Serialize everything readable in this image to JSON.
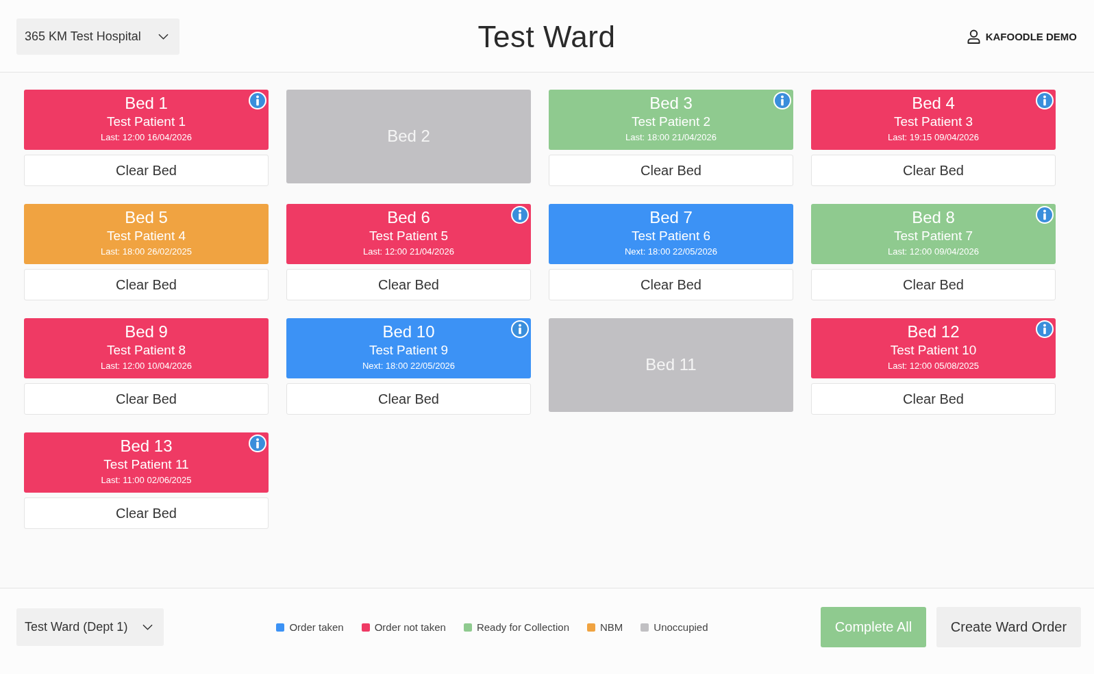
{
  "header": {
    "hospital_select": "365 KM Test Hospital",
    "title": "Test Ward",
    "user": "KAFOODLE DEMO"
  },
  "beds": [
    {
      "kind": "occupied",
      "name": "Bed 1",
      "patient": "Test Patient 1",
      "order_time": "Last: 12:00 16/04/2026",
      "color": "#ef3a64",
      "info": true,
      "action": "Clear Bed"
    },
    {
      "kind": "unoccupied",
      "name": "Bed 2",
      "color": "#c1c0c3"
    },
    {
      "kind": "occupied",
      "name": "Bed 3",
      "patient": "Test Patient 2",
      "order_time": "Last: 18:00 21/04/2026",
      "color": "#8fca8f",
      "info": true,
      "action": "Clear Bed"
    },
    {
      "kind": "occupied",
      "name": "Bed 4",
      "patient": "Test Patient 3",
      "order_time": "Last: 19:15 09/04/2026",
      "color": "#ef3a64",
      "info": true,
      "action": "Clear Bed"
    },
    {
      "kind": "occupied",
      "name": "Bed 5",
      "patient": "Test Patient 4",
      "order_time": "Last: 18:00 26/02/2025",
      "color": "#f0a341",
      "info": false,
      "action": "Clear Bed"
    },
    {
      "kind": "occupied",
      "name": "Bed 6",
      "patient": "Test Patient 5",
      "order_time": "Last: 12:00 21/04/2026",
      "color": "#ef3a64",
      "info": true,
      "action": "Clear Bed"
    },
    {
      "kind": "occupied",
      "name": "Bed 7",
      "patient": "Test Patient 6",
      "order_time": "Next: 18:00 22/05/2026",
      "color": "#3c92f5",
      "info": false,
      "action": "Clear Bed"
    },
    {
      "kind": "occupied",
      "name": "Bed 8",
      "patient": "Test Patient 7",
      "order_time": "Last: 12:00 09/04/2026",
      "color": "#8fca8f",
      "info": true,
      "action": "Clear Bed"
    },
    {
      "kind": "occupied",
      "name": "Bed 9",
      "patient": "Test Patient 8",
      "order_time": "Last: 12:00 10/04/2026",
      "color": "#ef3a64",
      "info": false,
      "action": "Clear Bed"
    },
    {
      "kind": "occupied",
      "name": "Bed 10",
      "patient": "Test Patient 9",
      "order_time": "Next: 18:00 22/05/2026",
      "color": "#3c92f5",
      "info": true,
      "action": "Clear Bed"
    },
    {
      "kind": "unoccupied",
      "name": "Bed 11",
      "color": "#c1c0c3"
    },
    {
      "kind": "occupied",
      "name": "Bed 12",
      "patient": "Test Patient 10",
      "order_time": "Last: 12:00 05/08/2025",
      "color": "#ef3a64",
      "info": true,
      "action": "Clear Bed"
    },
    {
      "kind": "occupied",
      "name": "Bed 13",
      "patient": "Test Patient 11",
      "order_time": "Last: 11:00 02/06/2025",
      "color": "#ef3a64",
      "info": true,
      "action": "Clear Bed"
    }
  ],
  "footer": {
    "ward_select": "Test Ward (Dept 1)",
    "legend": [
      {
        "label": "Order taken",
        "color": "#3c92f5"
      },
      {
        "label": "Order not taken",
        "color": "#ef3a64"
      },
      {
        "label": "Ready for Collection",
        "color": "#8fca8f"
      },
      {
        "label": "NBM",
        "color": "#f0a341"
      },
      {
        "label": "Unoccupied",
        "color": "#c1c0c3"
      }
    ],
    "buttons": [
      {
        "label": "Complete All",
        "kind": "primary"
      },
      {
        "label": "Create Ward Order",
        "kind": "secondary"
      }
    ]
  }
}
